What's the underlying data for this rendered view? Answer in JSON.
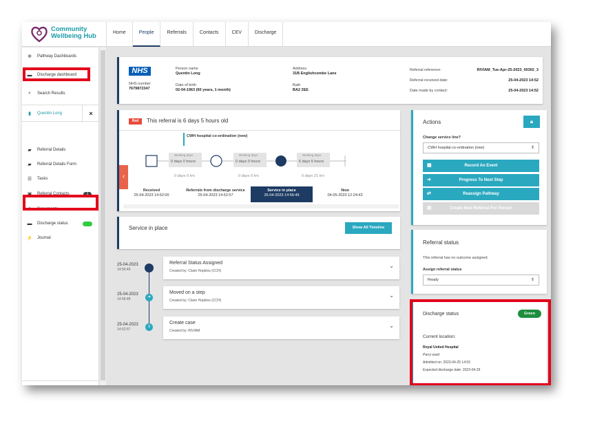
{
  "app": {
    "logo_text": "Community\nWellbeing Hub",
    "accent": "#1a9aa5"
  },
  "nav_tabs": [
    "Home",
    "People",
    "Referrals",
    "Contacts",
    "CEV",
    "Discharge"
  ],
  "sidebar": {
    "items": [
      {
        "label": "Pathway Dashboards",
        "icon": "dashboard-icon"
      },
      {
        "label": "Discharge dashboard",
        "icon": "bed-icon"
      },
      {
        "label": "Search Results",
        "icon": "search-icon"
      },
      {
        "label": "Quentin Long",
        "icon": "document-icon"
      },
      {
        "label": "Referral Details",
        "icon": "folder-icon"
      },
      {
        "label": "Referral Details Form",
        "icon": "folder-icon"
      },
      {
        "label": "Tasks",
        "icon": "list-icon"
      },
      {
        "label": "Referral Contacts",
        "icon": "contact-icon",
        "badge": "1"
      },
      {
        "label": "Documents",
        "icon": "paperclip-icon"
      },
      {
        "label": "Discharge status",
        "icon": "bed-icon"
      },
      {
        "label": "Journal",
        "icon": "journal-icon"
      }
    ],
    "close": "×"
  },
  "patient": {
    "nhs_logo": "NHS",
    "nhs_number_label": "NHS number",
    "nhs_number": "7679872347",
    "person_name_label": "Person name",
    "person_name": "Quentin Long",
    "dob_label": "Date of birth",
    "dob": "02-04-1963 (60 years, 1 month)",
    "address_label": "Address",
    "address_line1": "31B Englishcombe Lane",
    "address_line2": "Bath",
    "postcode": "BA2 2EE",
    "ref_label": "Referral reference:",
    "ref_value": "RIVIAM_Tue-Apr-25-2023_00302_3",
    "received_label": "Referral received date:",
    "received_value": "25-04-2023 14:52",
    "made_label": "Date made by contact:",
    "made_value": "25-04-2023 14:52"
  },
  "referral_banner": {
    "badge": "Red",
    "text": "This referral is 6 days 5 hours old",
    "current_step": "CWH hospital co-ordination (new)",
    "working_days_label": "Working days",
    "durations": [
      "0 days 0 hours",
      "0 days 0 hours",
      "6 days 5 hours"
    ],
    "below": [
      "0 days 0 hrs",
      "0 days 0 hrs",
      "6 days 21 hrs"
    ],
    "stages": [
      {
        "name": "Received",
        "date": "25-04-2023 14:52:00"
      },
      {
        "name": "Referrals from discharge service",
        "date": "25-04-2023 14:52:57"
      },
      {
        "name": "Service in place",
        "date": "25-04-2023 14:56:49"
      },
      {
        "name": "Now",
        "date": "04-05-2023 12:24:43"
      }
    ],
    "prev_arrow": "‹"
  },
  "service": {
    "title": "Service in place",
    "button": "Show All Timeline"
  },
  "timeline": [
    {
      "date": "25-04-2023",
      "time": "14:56:49",
      "title": "Referral Status Assigned",
      "by": "Created by: Claire Hopkins (CCH)"
    },
    {
      "date": "25-04-2023",
      "time": "14:56:48",
      "title": "Moved on a step",
      "by": "Created by: Claire Hopkins (CCH)"
    },
    {
      "date": "25-04-2023",
      "time": "14:52:57",
      "title": "Create case",
      "by": "Created by: RIVIAM"
    }
  ],
  "actions": {
    "title": "Actions",
    "change_label": "Change service line?",
    "change_value": "CWH hospital co-ordination (new)",
    "buttons": [
      "Record An Event",
      "Progress To Next Step",
      "Reassign Pathway",
      "Create New Referral For Person"
    ]
  },
  "referral_status": {
    "title": "Referral status",
    "note": "This referral has no outcome assigned.",
    "assign_label": "Assign referral status",
    "assign_value": "Ready"
  },
  "discharge": {
    "title": "Discharge status",
    "badge": "Green",
    "current_location_label": "Current location:",
    "hospital": "Royal United Hospital",
    "ward": "Parry ward",
    "admitted": "Admitted on: 2023-04-25 14:53",
    "expected": "Expected discharge date: 2023-04-26"
  }
}
